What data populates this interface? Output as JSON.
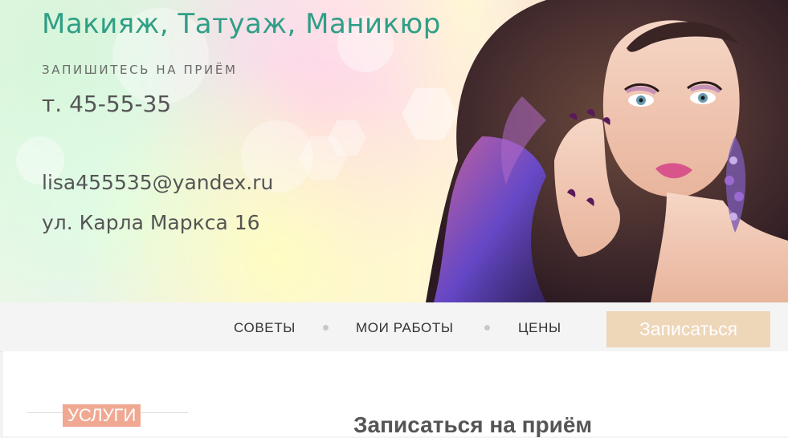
{
  "header": {
    "title": "Макияж, Татуаж, Маникюр",
    "appointment_label": "ЗАПИШИТЕСЬ НА ПРИЁМ",
    "phone": "т. 45-55-35",
    "email": "lisa455535@yandex.ru",
    "address": "ул. Карла Маркса 16"
  },
  "nav": {
    "items": [
      {
        "label": "СОВЕТЫ"
      },
      {
        "label": "МОИ РАБОТЫ"
      },
      {
        "label": "ЦЕНЫ"
      }
    ],
    "cta_label": "Записаться"
  },
  "sidebar": {
    "services_label": "УСЛУГИ"
  },
  "main": {
    "form_title": "Записаться на приём"
  },
  "colors": {
    "title": "#2e9f86",
    "cta": "#eed6b8",
    "services_badge": "#f0a892"
  }
}
